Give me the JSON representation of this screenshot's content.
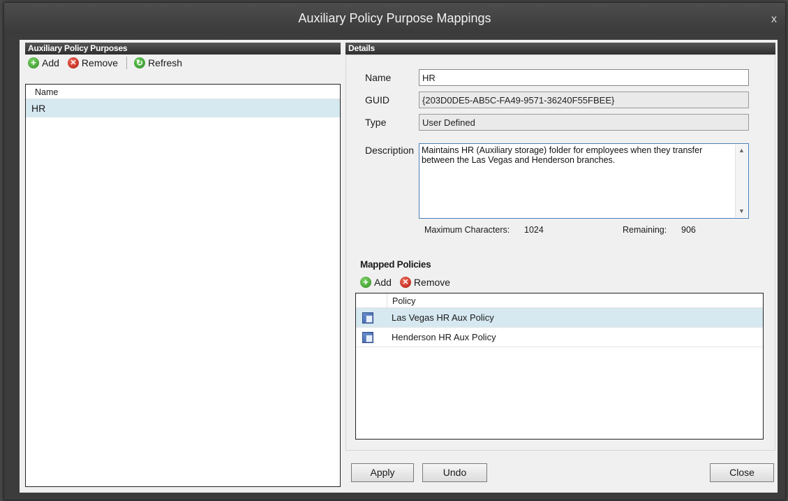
{
  "window": {
    "title": "Auxiliary Policy Purpose Mappings",
    "close_glyph": "x"
  },
  "left": {
    "header": "Auxiliary Policy Purposes",
    "toolbar": {
      "add_label": "Add",
      "remove_label": "Remove",
      "refresh_label": "Refresh"
    },
    "list": {
      "column_header": "Name",
      "rows": [
        {
          "name": "HR",
          "selected": true
        }
      ]
    }
  },
  "details": {
    "header": "Details",
    "name_label": "Name",
    "name_value": "HR",
    "guid_label": "GUID",
    "guid_value": "{203D0DE5-AB5C-FA49-9571-36240F55FBEE}",
    "type_label": "Type",
    "type_value": "User Defined",
    "description_label": "Description",
    "description_value": "Maintains HR (Auxiliary storage) folder for employees when they transfer between the Las Vegas and Henderson branches.",
    "max_chars_label": "Maximum Characters:",
    "max_chars_value": "1024",
    "remaining_label": "Remaining:",
    "remaining_value": "906"
  },
  "mapped": {
    "title": "Mapped Policies",
    "add_label": "Add",
    "remove_label": "Remove",
    "column_header": "Policy",
    "rows": [
      {
        "name": "Las Vegas HR Aux Policy",
        "selected": true
      },
      {
        "name": "Henderson HR Aux Policy",
        "selected": false
      }
    ]
  },
  "buttons": {
    "apply": "Apply",
    "undo": "Undo",
    "close": "Close"
  },
  "icons": {
    "add": "plus-circle-icon",
    "remove": "x-circle-icon",
    "refresh": "refresh-icon",
    "policy": "policy-document-icon"
  },
  "colors": {
    "selection": "#d6e8f0",
    "header_bg": "#3a3a3a",
    "add_green": "#2e8b1f",
    "remove_red": "#b11b10"
  }
}
